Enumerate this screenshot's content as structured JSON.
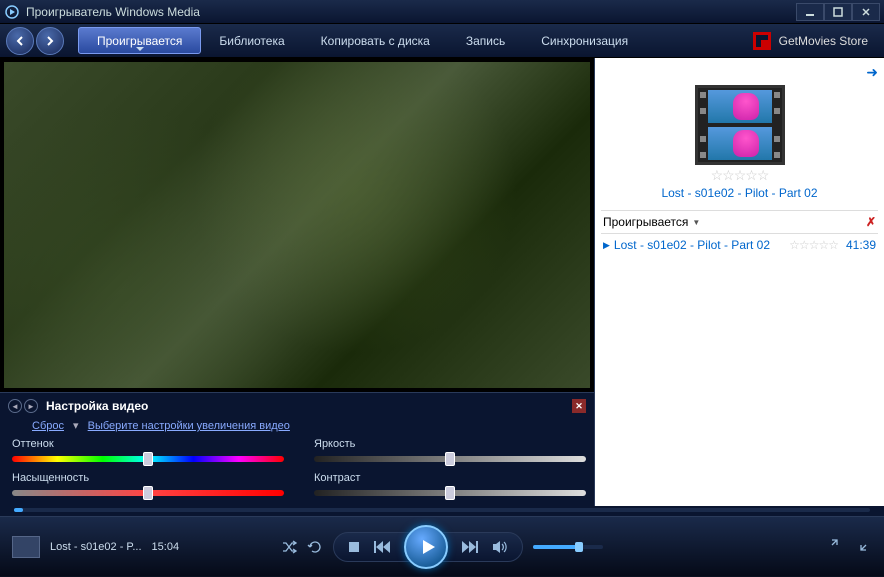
{
  "window": {
    "title": "Проигрыватель Windows Media"
  },
  "nav": {
    "back": "back",
    "forward": "forward"
  },
  "tabs": {
    "now_playing": "Проигрывается",
    "library": "Библиотека",
    "rip": "Копировать с диска",
    "burn": "Запись",
    "sync": "Синхронизация"
  },
  "store": {
    "label": "GetMovies Store"
  },
  "video_settings": {
    "title": "Настройка видео",
    "reset": "Сброс",
    "zoom_link": "Выберите настройки увеличения видео",
    "hue": "Оттенок",
    "brightness": "Яркость",
    "saturation": "Насыщенность",
    "contrast": "Контраст"
  },
  "playlist": {
    "title": "Lost - s01e02 - Pilot - Part 02",
    "header": "Проигрывается",
    "item_title": "Lost - s01e02 - Pilot - Part 02",
    "item_duration": "41:39"
  },
  "now_playing": {
    "title": "Lost - s01e02 - P...",
    "time": "15:04"
  }
}
